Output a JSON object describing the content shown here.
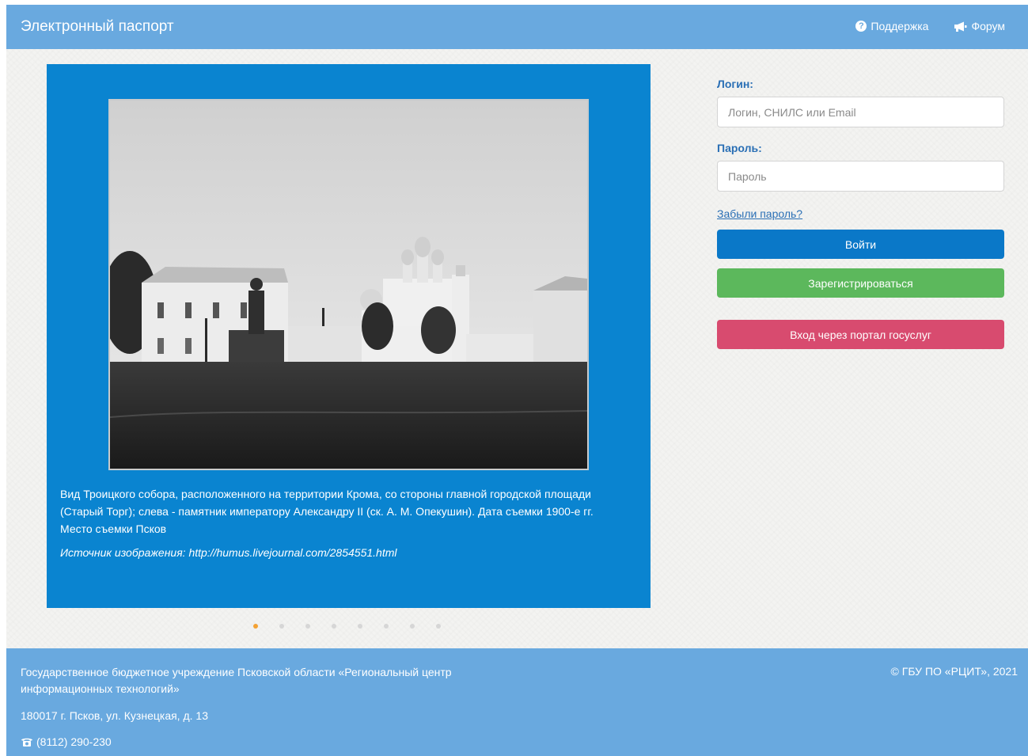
{
  "header": {
    "brand": "Электронный паспорт",
    "nav": [
      {
        "label": "Поддержка",
        "icon": "question-circle-icon"
      },
      {
        "label": "Форум",
        "icon": "bullhorn-icon"
      }
    ]
  },
  "slider": {
    "caption": "Вид Троицкого собора, расположенного на территории Крома, со стороны главной городской площади (Старый Торг); слева - памятник императору Александру II (ск. А. М. Опекушин). Дата съемки 1900-е гг. Место съемки Псков",
    "source": "Источник изображения: http://humus.livejournal.com/2854551.html",
    "dots_count": 8,
    "active_dot": 0
  },
  "login": {
    "login_label": "Логин:",
    "login_placeholder": "Логин, СНИЛС или Email",
    "password_label": "Пароль:",
    "password_placeholder": "Пароль",
    "forgot": "Забыли пароль?",
    "login_button": "Войти",
    "register_button": "Зарегистрироваться",
    "gosuslugi_button": "Вход через портал госуслуг"
  },
  "footer": {
    "org": "Государственное бюджетное учреждение Псковской области «Региональный центр информационных технологий»",
    "address": "180017 г. Псков, ул. Кузнецкая, д. 13",
    "phone": "(8112) 290-230",
    "copyright": "© ГБУ ПО «РЦИТ», 2021"
  },
  "colors": {
    "header_bg": "#69a9df",
    "slider_bg": "#0a84d0",
    "login_btn": "#0a78c8",
    "register_btn": "#5cb85c",
    "gos_btn": "#d84b6f",
    "label": "#2a6fb5"
  }
}
